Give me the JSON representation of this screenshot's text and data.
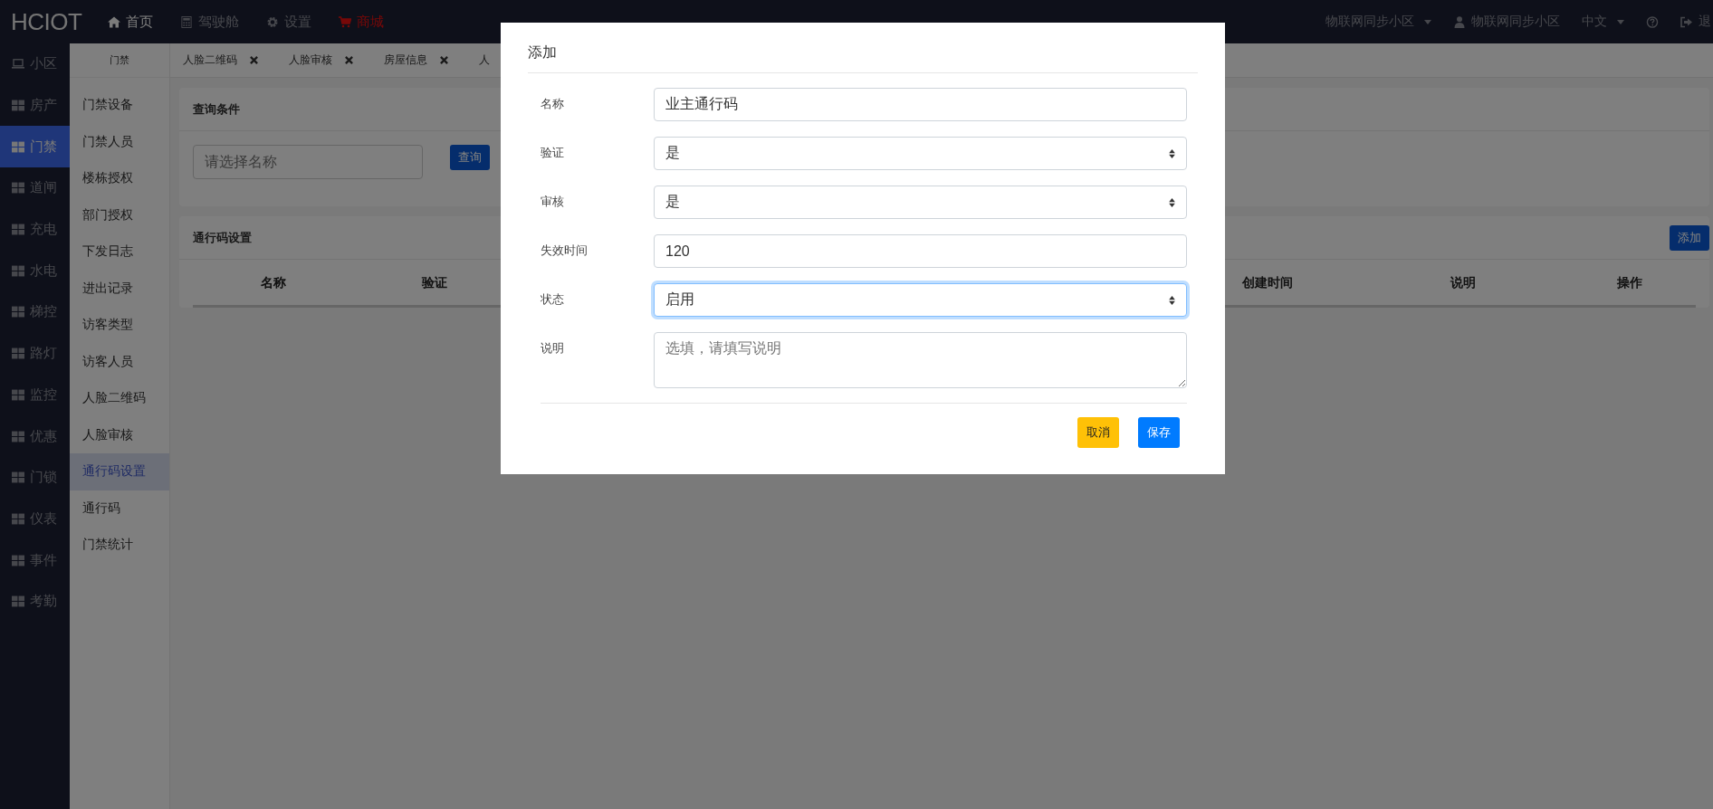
{
  "topbar": {
    "logo": "HCIOT",
    "nav": [
      {
        "kind": "home",
        "label": "首页",
        "selected": true
      },
      {
        "kind": "calculator",
        "label": "驾驶舱",
        "selected": false
      },
      {
        "kind": "gear",
        "label": "设置",
        "selected": false
      },
      {
        "kind": "shop",
        "label": "商城",
        "selected": false
      }
    ],
    "right": [
      {
        "kind": "dropdown",
        "label": "物联网同步小区"
      },
      {
        "kind": "user",
        "label": "物联网同步小区"
      },
      {
        "kind": "dropdown",
        "label": "中文"
      },
      {
        "kind": "help"
      },
      {
        "kind": "logout",
        "label": "退"
      }
    ]
  },
  "sidebar": {
    "items": [
      {
        "kind": "monitor",
        "label": "小区",
        "selected": false
      },
      {
        "kind": "grid",
        "label": "房产",
        "selected": false
      },
      {
        "kind": "grid",
        "label": "门禁",
        "selected": true
      },
      {
        "kind": "grid",
        "label": "道闸",
        "selected": false
      },
      {
        "kind": "grid",
        "label": "充电",
        "selected": false
      },
      {
        "kind": "grid",
        "label": "水电",
        "selected": false
      },
      {
        "kind": "grid",
        "label": "梯控",
        "selected": false
      },
      {
        "kind": "grid",
        "label": "路灯",
        "selected": false
      },
      {
        "kind": "grid",
        "label": "监控",
        "selected": false
      },
      {
        "kind": "grid",
        "label": "优惠",
        "selected": false
      },
      {
        "kind": "grid",
        "label": "门锁",
        "selected": false
      },
      {
        "kind": "grid",
        "label": "仪表",
        "selected": false
      },
      {
        "kind": "grid",
        "label": "事件",
        "selected": false
      },
      {
        "kind": "grid",
        "label": "考勤",
        "selected": false
      }
    ]
  },
  "submenu": {
    "title": "门禁",
    "items": [
      {
        "label": "门禁设备",
        "selected": false
      },
      {
        "label": "门禁人员",
        "selected": false
      },
      {
        "label": "楼栋授权",
        "selected": false
      },
      {
        "label": "部门授权",
        "selected": false
      },
      {
        "label": "下发日志",
        "selected": false
      },
      {
        "label": "进出记录",
        "selected": false
      },
      {
        "label": "访客类型",
        "selected": false
      },
      {
        "label": "访客人员",
        "selected": false
      },
      {
        "label": "人脸二维码",
        "selected": false
      },
      {
        "label": "人脸审核",
        "selected": false
      },
      {
        "label": "通行码设置",
        "selected": true
      },
      {
        "label": "通行码",
        "selected": false
      },
      {
        "label": "门禁统计",
        "selected": false
      }
    ]
  },
  "tabs": [
    {
      "label": "人脸二维码",
      "closable": true
    },
    {
      "label": "人脸审核",
      "closable": true
    },
    {
      "label": "房屋信息",
      "closable": true
    },
    {
      "label": "人",
      "closable": false
    }
  ],
  "query": {
    "title": "查询条件",
    "field": {
      "placeholder": "请选择名称"
    },
    "button": "查询"
  },
  "settings": {
    "title": "通行码设置",
    "add_button": "添加",
    "columns_left": [
      "名称",
      "验证"
    ],
    "columns_right": [
      "创建时间",
      "说明",
      "操作"
    ]
  },
  "modal": {
    "title": "添加",
    "fields": [
      {
        "label": "名称",
        "kind": "text",
        "value": "业主通行码",
        "focused": false
      },
      {
        "label": "验证",
        "kind": "select",
        "value": "是",
        "focused": false
      },
      {
        "label": "审核",
        "kind": "select",
        "value": "是",
        "focused": false
      },
      {
        "label": "失效时间",
        "kind": "text",
        "value": "120",
        "focused": false
      },
      {
        "label": "状态",
        "kind": "select",
        "value": "启用",
        "focused": true
      },
      {
        "label": "说明",
        "kind": "textarea",
        "placeholder": "选填，请填写说明",
        "focused": false
      }
    ],
    "buttons": [
      {
        "label": "取消",
        "kind": "warning"
      },
      {
        "label": "保存",
        "kind": "primary"
      }
    ]
  }
}
